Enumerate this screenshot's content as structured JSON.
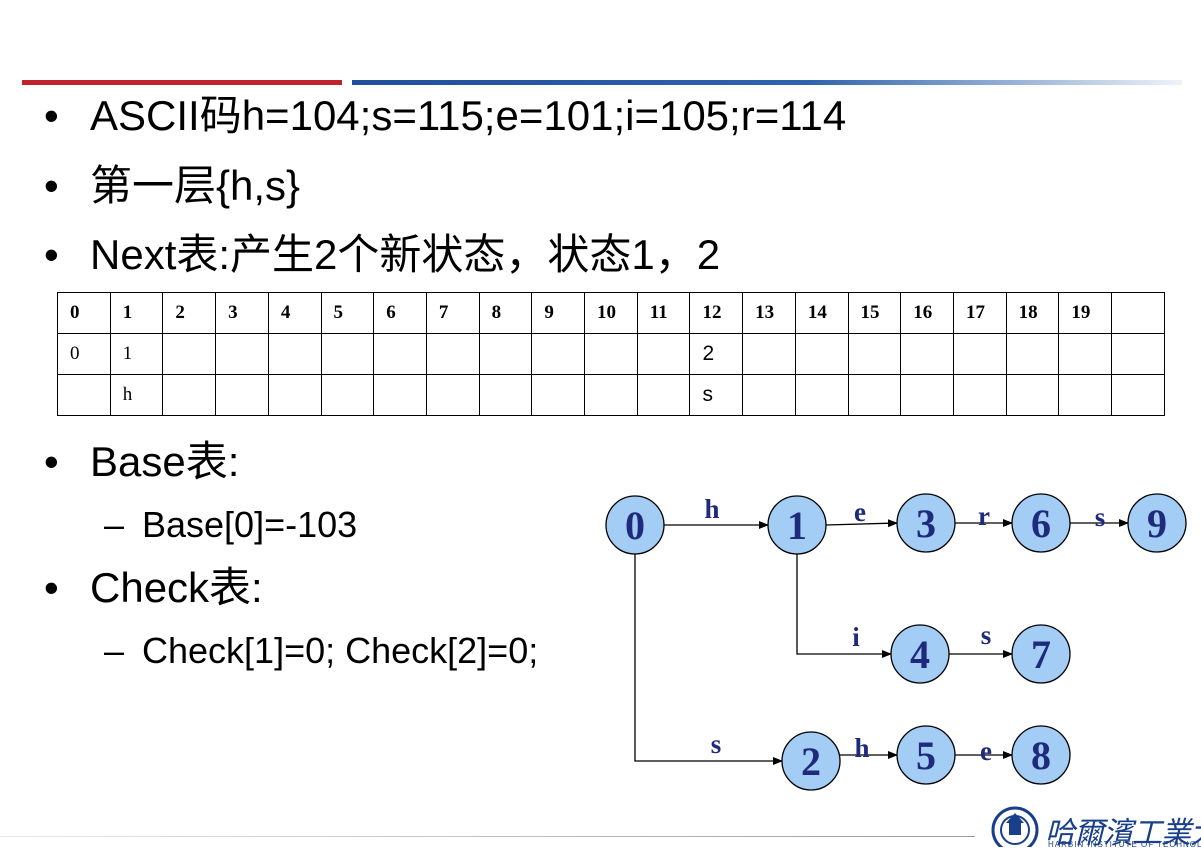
{
  "bullets": {
    "ascii": "ASCII码h=104;s=115;e=101;i=105;r=114",
    "layer1": "第一层{h,s}",
    "next": "Next表:产生2个新状态，状态1，2",
    "base": "Base表:",
    "base_sub": "Base[0]=-103",
    "check": "Check表:",
    "check_sub": "Check[1]=0; Check[2]=0;"
  },
  "bullet_glyph": "•",
  "dash_glyph": "–",
  "next_table": {
    "header": [
      "0",
      "1",
      "2",
      "3",
      "4",
      "5",
      "6",
      "7",
      "8",
      "9",
      "10",
      "11",
      "12",
      "13",
      "14",
      "15",
      "16",
      "17",
      "18",
      "19",
      ""
    ],
    "row_state": [
      "0",
      "1",
      "",
      "",
      "",
      "",
      "",
      "",
      "",
      "",
      "",
      "",
      "2",
      "",
      "",
      "",
      "",
      "",
      "",
      "",
      ""
    ],
    "row_char": [
      "",
      "h",
      "",
      "",
      "",
      "",
      "",
      "",
      "",
      "",
      "",
      "",
      "s",
      "",
      "",
      "",
      "",
      "",
      "",
      "",
      ""
    ]
  },
  "trie": {
    "nodes": [
      "0",
      "1",
      "2",
      "3",
      "4",
      "5",
      "6",
      "7",
      "8",
      "9"
    ],
    "edges": [
      {
        "from": "0",
        "to": "1",
        "label": "h"
      },
      {
        "from": "0",
        "to": "2",
        "label": "s"
      },
      {
        "from": "1",
        "to": "3",
        "label": "e"
      },
      {
        "from": "1",
        "to": "4",
        "label": "i"
      },
      {
        "from": "3",
        "to": "6",
        "label": "r"
      },
      {
        "from": "6",
        "to": "9",
        "label": "s"
      },
      {
        "from": "4",
        "to": "7",
        "label": "s"
      },
      {
        "from": "2",
        "to": "5",
        "label": "h"
      },
      {
        "from": "5",
        "to": "8",
        "label": "e"
      }
    ],
    "node_fill": "#a3cdf5",
    "node_text_color": "#1f2a7c"
  },
  "logo": {
    "name": "哈爾濱工業大學",
    "sub": "HARBIN INSTITUTE OF TECHNOLOGY",
    "color": "#1a3f8a"
  }
}
